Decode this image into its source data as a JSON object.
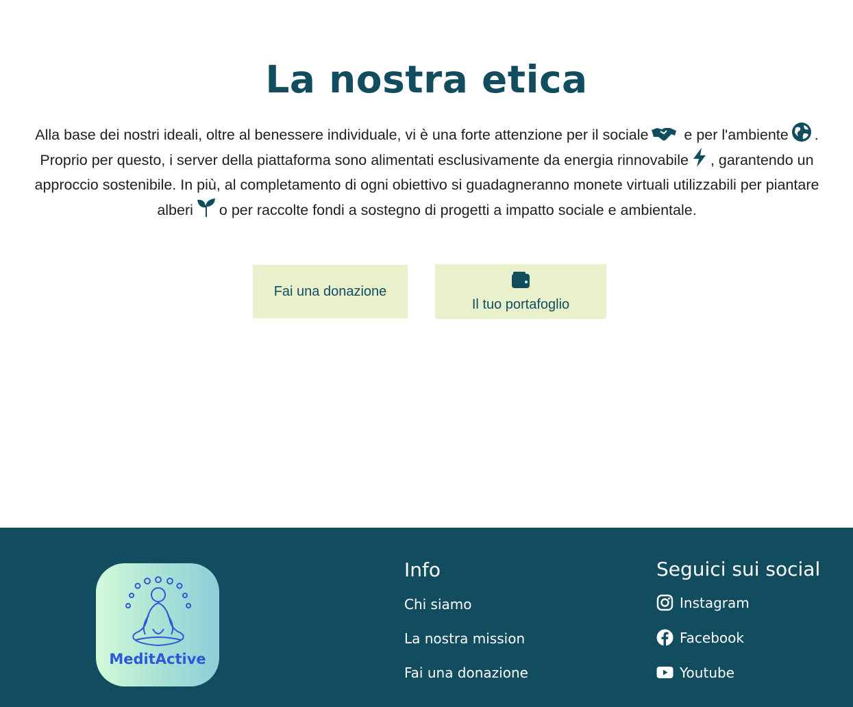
{
  "ethics": {
    "title": "La nostra etica",
    "intro_parts": [
      "Alla base dei nostri ideali, oltre al benessere individuale, vi è una forte attenzione per il sociale",
      "e per l'ambiente",
      ". Proprio per questo, i server della piattaforma sono alimentati esclusivamente da energia rinnovabile",
      ", garantendo un approccio sostenibile. In più, al completamento di ogni obiettivo si guadagneranno monete virtuali utilizzabili per piantare alberi",
      "o per raccolte fondi a sostegno di progetti a impatto sociale e ambientale."
    ],
    "icons": [
      "handshake-icon",
      "globe-icon",
      "lightning-bolt-icon",
      "seedling-icon"
    ]
  },
  "actions": {
    "donate_label": "Fai una donazione",
    "wallet_label": "Il tuo portafoglio",
    "wallet_icon": "wallet-icon"
  },
  "footer": {
    "logo_text": "MeditActive",
    "info": {
      "title": "Info",
      "links": [
        "Chi siamo",
        "La nostra mission",
        "Fai una donazione"
      ]
    },
    "social": {
      "title": "Seguici sui social",
      "links": [
        {
          "label": "Instagram",
          "icon": "instagram-icon"
        },
        {
          "label": "Facebook",
          "icon": "facebook-icon"
        },
        {
          "label": "Youtube",
          "icon": "youtube-icon"
        }
      ]
    }
  },
  "colors": {
    "primary": "#124c5f",
    "button_bg": "#e9f1cc",
    "logo_text": "#2c58d8"
  }
}
